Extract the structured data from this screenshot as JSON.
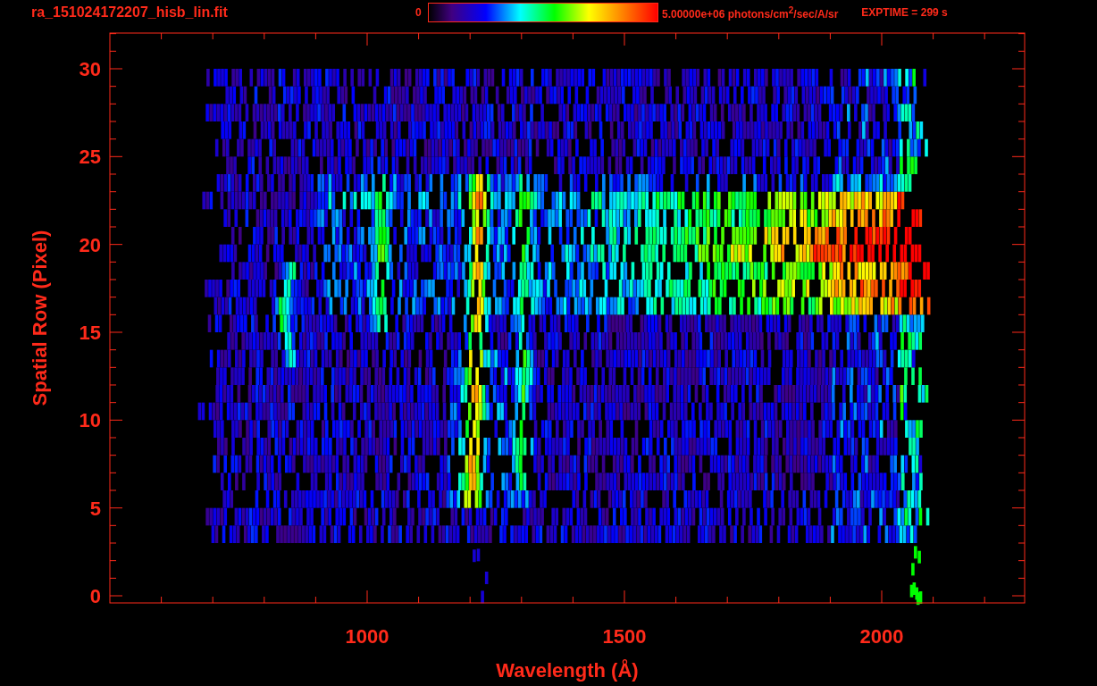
{
  "header": {
    "title": "ra_151024172207_hisb_lin.fit",
    "colorbar_min": "0",
    "colorbar_max": "5.00000e+06 photons/cm$^{2}$/sec/A/sr",
    "exposure": "EXPTIME = 299 s"
  },
  "plot": {
    "xlabel": "Wavelength (Å)",
    "ylabel": "Spatial Row (Pixel)",
    "xticks": [
      "1000",
      "1500",
      "2000"
    ],
    "yticks": [
      "30",
      "25",
      "20",
      "15",
      "10",
      "5",
      "0"
    ]
  }
}
